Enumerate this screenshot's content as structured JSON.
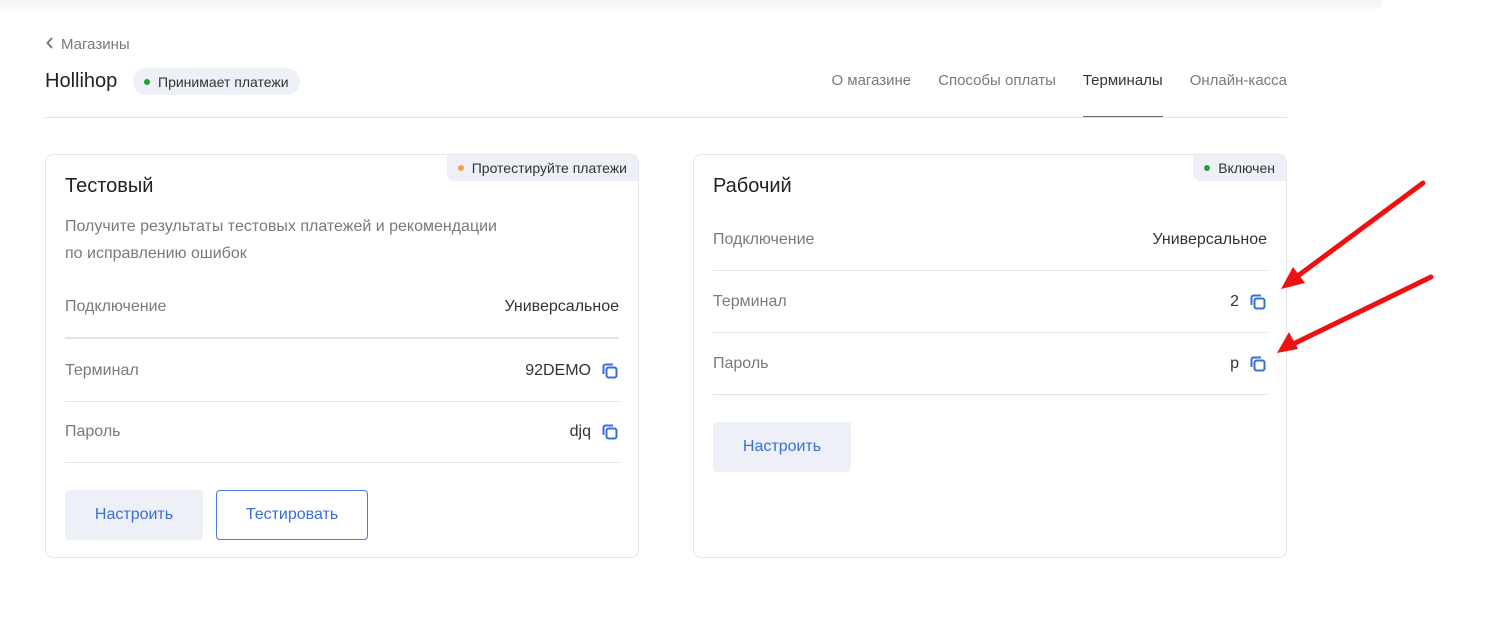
{
  "nav": {
    "back_label": "Магазины"
  },
  "shop": {
    "name": "Hollihop",
    "status": "Принимает платежи",
    "status_color": "#21a038"
  },
  "tabs": [
    {
      "label": "О магазине",
      "active": false
    },
    {
      "label": "Способы оплаты",
      "active": false
    },
    {
      "label": "Терминалы",
      "active": true
    },
    {
      "label": "Онлайн-касса",
      "active": false
    }
  ],
  "test_card": {
    "badge": "Протестируйте платежи",
    "badge_color": "#f5a04a",
    "title": "Тестовый",
    "description_line1": "Получите результаты тестовых платежей и рекомендации",
    "description_line2": "по исправлению ошибок",
    "rows": [
      {
        "label": "Подключение",
        "value": "Универсальное"
      },
      {
        "label": "Терминал",
        "value": "92DEMO"
      },
      {
        "label": "Пароль",
        "value": "djq"
      }
    ],
    "configure_label": "Настроить",
    "test_label": "Тестировать"
  },
  "prod_card": {
    "badge": "Включен",
    "badge_color": "#21a038",
    "title": "Рабочий",
    "rows": [
      {
        "label": "Подключение",
        "value": "Универсальное"
      },
      {
        "label": "Терминал",
        "value": "2"
      },
      {
        "label": "Пароль",
        "value": "p"
      }
    ],
    "configure_label": "Настроить"
  },
  "colors": {
    "accent": "#3b6fd8",
    "annotation_arrow": "#ee1111"
  },
  "icons": {
    "copy": "copy-icon",
    "back": "chevron-left-icon"
  }
}
